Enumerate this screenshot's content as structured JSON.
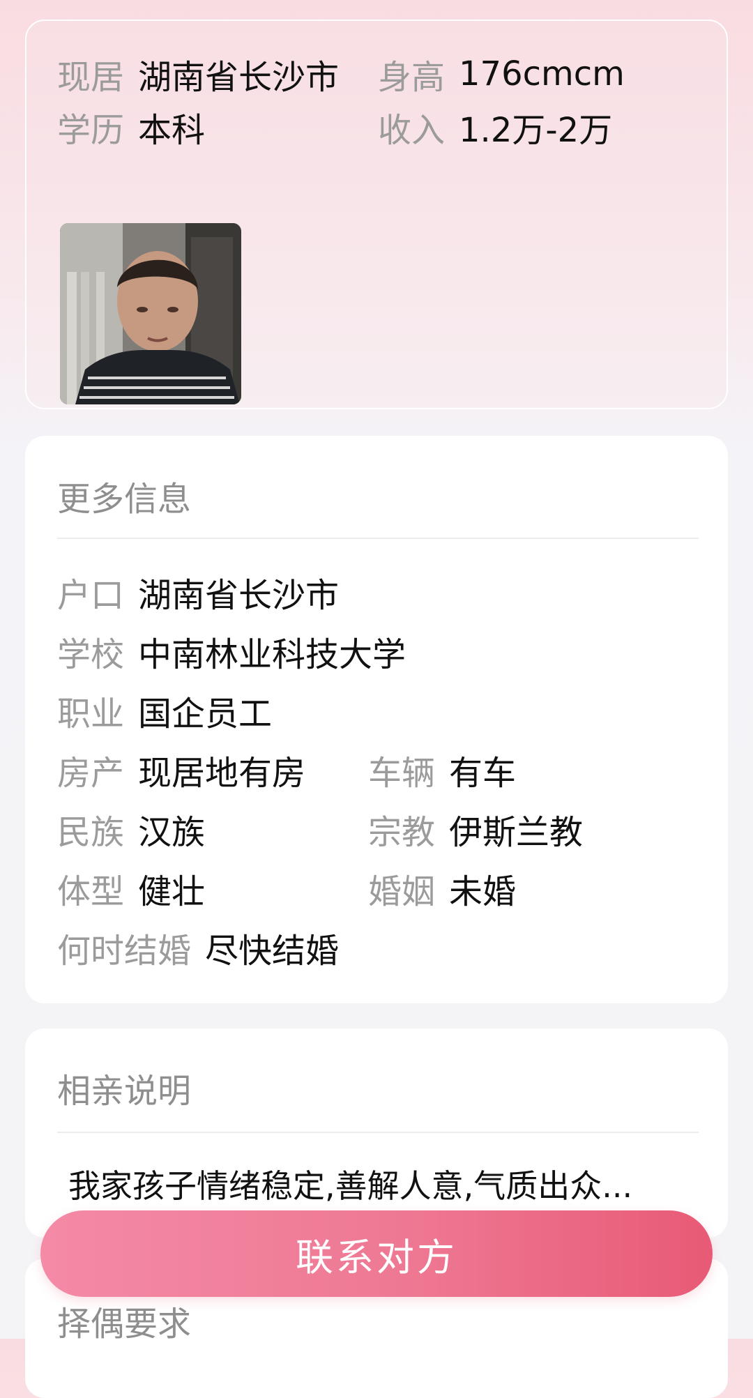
{
  "profile_card": {
    "residence_label": "现居",
    "residence_value": "湖南省长沙市",
    "height_label": "身高",
    "height_value": "176cmcm",
    "education_label": "学历",
    "education_value": "本科",
    "income_label": "收入",
    "income_value": "1.2万-2万",
    "avatar_icon": "user-photo"
  },
  "more_info": {
    "title": "更多信息",
    "hukou_label": "户口",
    "hukou_value": "湖南省长沙市",
    "school_label": "学校",
    "school_value": "中南林业科技大学",
    "job_label": "职业",
    "job_value": "国企员工",
    "property_label": "房产",
    "property_value": "现居地有房",
    "vehicle_label": "车辆",
    "vehicle_value": "有车",
    "ethnicity_label": "民族",
    "ethnicity_value": "汉族",
    "religion_label": "宗教",
    "religion_value": "伊斯兰教",
    "body_label": "体型",
    "body_value": "健壮",
    "marriage_label": "婚姻",
    "marriage_value": "未婚",
    "marry_when_label": "何时结婚",
    "marry_when_value": "尽快结婚"
  },
  "blind_date": {
    "title": "相亲说明",
    "description": "我家孩子情绪稳定,善解人意,气质出众..."
  },
  "partner_requirements": {
    "title": "择偶要求"
  },
  "actions": {
    "contact_label": "联系对方"
  },
  "colors": {
    "accent_start": "#f48aa6",
    "accent_end": "#e85a76",
    "label_gray": "#9b9b9b"
  }
}
